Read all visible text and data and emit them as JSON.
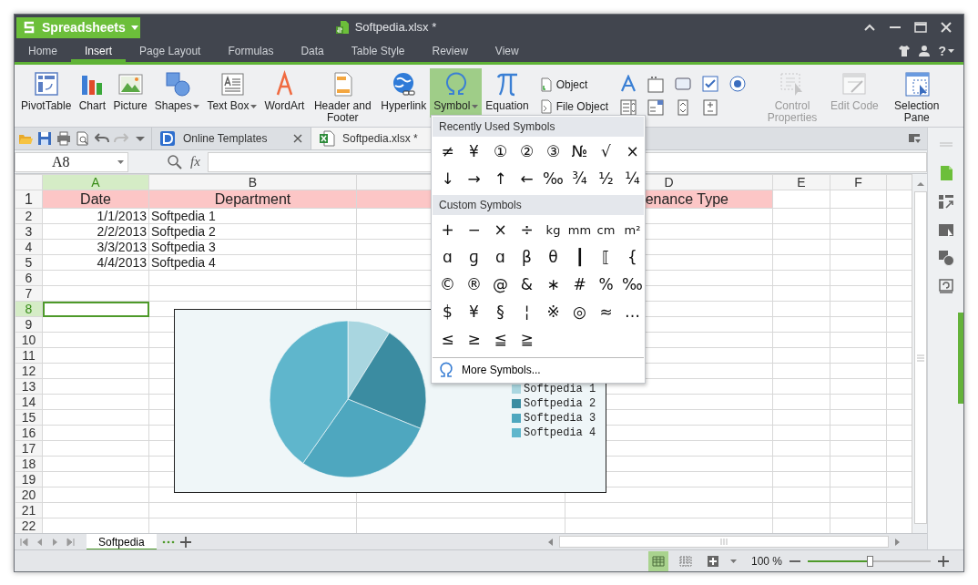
{
  "app_menu": {
    "label": "Spreadsheets"
  },
  "window": {
    "title": "Softpedia.xlsx *"
  },
  "menu_tabs": [
    {
      "label": "Home",
      "selected": false
    },
    {
      "label": "Insert",
      "selected": true
    },
    {
      "label": "Page Layout",
      "selected": false
    },
    {
      "label": "Formulas",
      "selected": false
    },
    {
      "label": "Data",
      "selected": false
    },
    {
      "label": "Table Style",
      "selected": false
    },
    {
      "label": "Review",
      "selected": false
    },
    {
      "label": "View",
      "selected": false
    }
  ],
  "help_button": {
    "label": "?"
  },
  "ribbon": {
    "buttons": [
      {
        "label": "PivotTable",
        "dropdown": false,
        "selected": false,
        "disabled": false
      },
      {
        "label": "Chart",
        "dropdown": false,
        "selected": false,
        "disabled": false
      },
      {
        "label": "Picture",
        "dropdown": false,
        "selected": false,
        "disabled": false
      },
      {
        "label": "Shapes",
        "dropdown": true,
        "selected": false,
        "disabled": false
      },
      {
        "label": "Text Box",
        "dropdown": true,
        "selected": false,
        "disabled": false
      },
      {
        "label": "WordArt",
        "dropdown": false,
        "selected": false,
        "disabled": false
      },
      {
        "label": "Header and Footer",
        "dropdown": false,
        "selected": false,
        "disabled": false
      },
      {
        "label": "Hyperlink",
        "dropdown": false,
        "selected": false,
        "disabled": false
      },
      {
        "label": "Symbol",
        "dropdown": true,
        "selected": true,
        "disabled": false
      },
      {
        "label": "Equation",
        "dropdown": false,
        "selected": false,
        "disabled": false
      }
    ],
    "object_buttons": [
      {
        "label": "Object"
      },
      {
        "label": "File Object"
      }
    ],
    "tool_buttons": [
      {
        "label": "Control Properties",
        "disabled": true
      },
      {
        "label": "Edit Code",
        "disabled": true
      },
      {
        "label": "Selection Pane",
        "disabled": false
      }
    ]
  },
  "document_tabs": [
    {
      "label": "Online Templates",
      "selected": false
    },
    {
      "label": "Softpedia.xlsx *",
      "selected": true
    }
  ],
  "formula_bar": {
    "name_box": "A8",
    "function_button": "fx"
  },
  "columns": [
    {
      "label": "A",
      "selected": true
    },
    {
      "label": "B",
      "selected": false
    },
    {
      "selected": false
    },
    {
      "label": "D",
      "selected": false
    },
    {
      "label": "E",
      "selected": false
    },
    {
      "label": "F",
      "selected": false
    },
    {
      "selected": false
    }
  ],
  "rows": [
    {
      "number": "1",
      "selected": false,
      "cells": [
        {
          "kind": "header",
          "text": "Date"
        },
        {
          "kind": "header",
          "text": "Department"
        },
        {
          "kind": "header"
        },
        {
          "kind": "header",
          "text": "enance Type"
        }
      ]
    },
    {
      "number": "2",
      "selected": false,
      "cells": [
        {
          "kind": "date",
          "text": "1/1/2013"
        },
        {
          "kind": "text",
          "text": "Softpedia 1"
        }
      ]
    },
    {
      "number": "3",
      "selected": false,
      "cells": [
        {
          "kind": "date",
          "text": "2/2/2013"
        },
        {
          "kind": "text",
          "text": "Softpedia 2"
        }
      ]
    },
    {
      "number": "4",
      "selected": false,
      "cells": [
        {
          "kind": "date",
          "text": "3/3/2013"
        },
        {
          "kind": "text",
          "text": "Softpedia 3"
        }
      ]
    },
    {
      "number": "5",
      "selected": false,
      "cells": [
        {
          "kind": "date",
          "text": "4/4/2013"
        },
        {
          "kind": "text",
          "text": "Softpedia 4"
        }
      ]
    },
    {
      "number": "6",
      "selected": false
    },
    {
      "number": "7",
      "selected": false
    },
    {
      "number": "8",
      "selected": true
    },
    {
      "number": "9",
      "selected": false
    },
    {
      "number": "10",
      "selected": false
    },
    {
      "number": "11",
      "selected": false
    },
    {
      "number": "12",
      "selected": false
    },
    {
      "number": "13",
      "selected": false
    },
    {
      "number": "14",
      "selected": false
    },
    {
      "number": "15",
      "selected": false
    },
    {
      "number": "16",
      "selected": false
    },
    {
      "number": "17",
      "selected": false
    },
    {
      "number": "18",
      "selected": false
    },
    {
      "number": "19",
      "selected": false
    },
    {
      "number": "20",
      "selected": false
    },
    {
      "number": "21",
      "selected": false
    },
    {
      "number": "22",
      "selected": false
    }
  ],
  "chart": {
    "legend": [
      {
        "label": "Softpedia 1",
        "color": "#a9d6e0"
      },
      {
        "label": "Softpedia 2",
        "color": "#3b8ca1"
      },
      {
        "label": "Softpedia 3",
        "color": "#4ea7bf"
      },
      {
        "label": "Softpedia 4",
        "color": "#5fb6cc"
      }
    ]
  },
  "symbol_menu": {
    "recent_header": "Recently Used Symbols",
    "recent": [
      "≠",
      "¥",
      "①",
      "②",
      "③",
      "№",
      "√",
      "×",
      "↓",
      "→",
      "↑",
      "←",
      "‰",
      "¾",
      "½",
      "¼"
    ],
    "custom_header": "Custom Symbols",
    "custom": [
      "+",
      "−",
      "×",
      "÷",
      "kg",
      "mm",
      "cm",
      "m²",
      "ɑ",
      "ɡ",
      "ɑ",
      "β",
      "θ",
      "┃",
      "⟦",
      "{",
      "©",
      "®",
      "@",
      "&",
      "∗",
      "#",
      "%",
      "‰",
      "$",
      "¥",
      "§",
      "¦",
      "※",
      "◎",
      "≈",
      "…",
      "≤",
      "≥",
      "≦",
      "≧"
    ],
    "more_label": "More Symbols..."
  },
  "sheet_tabs": [
    {
      "label": "Softpedia",
      "selected": true
    }
  ],
  "status_bar": {
    "view_buttons": [
      {
        "selected": true
      },
      {
        "selected": false
      },
      {
        "selected": false
      }
    ],
    "zoom_label": "100 %",
    "zoom_slider": {
      "level": 0.5
    }
  }
}
